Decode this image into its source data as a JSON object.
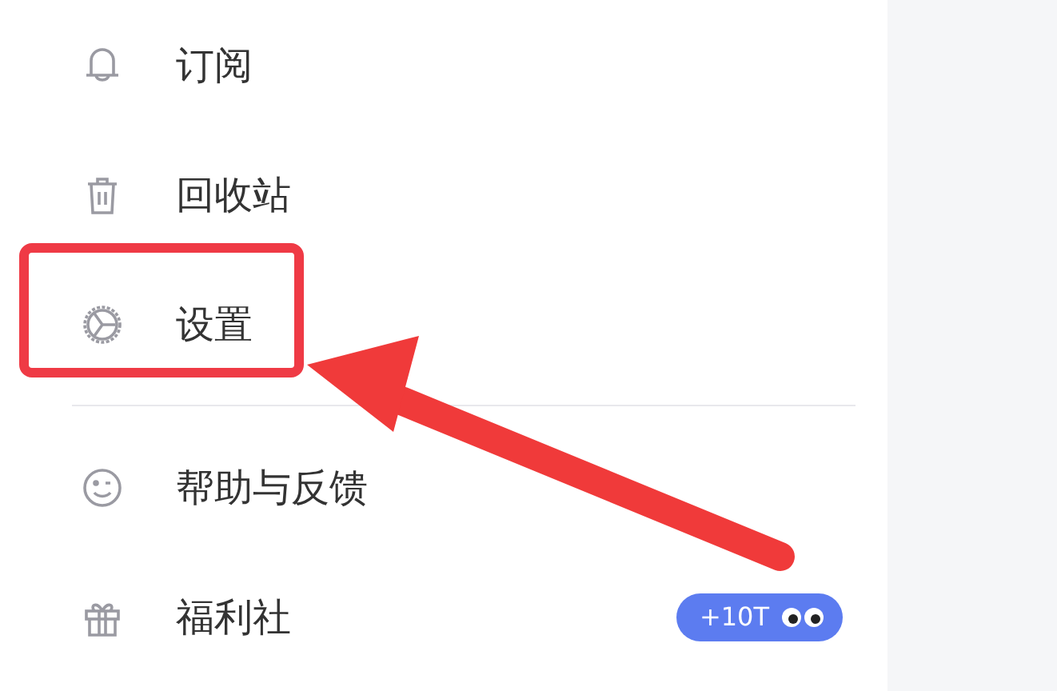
{
  "menu_groups": [
    {
      "items": [
        {
          "label": "订阅",
          "highlighted": false
        },
        {
          "label": "回收站",
          "highlighted": false
        },
        {
          "label": "设置",
          "highlighted": true
        }
      ]
    },
    {
      "items": [
        {
          "label": "帮助与反馈",
          "highlighted": false
        },
        {
          "label": "福利社",
          "highlighted": false,
          "badge": "+10T"
        }
      ]
    }
  ]
}
